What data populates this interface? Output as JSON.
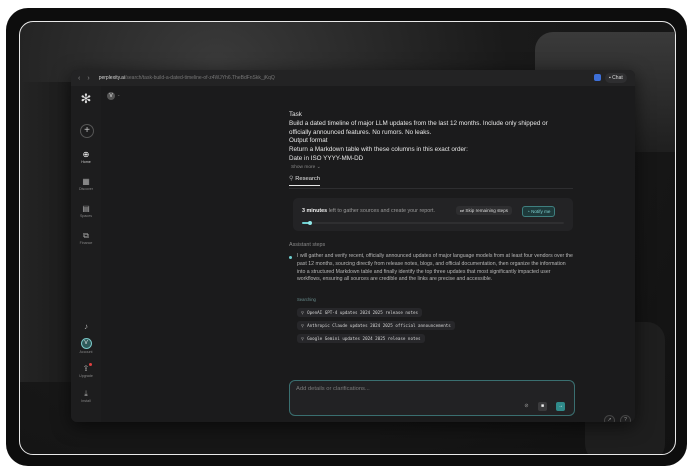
{
  "browser": {
    "url_domain": "perplexity.ai",
    "url_path": "/search/task-build-a-dated-timeline-of-z4WJYh6.TheBdFnSkk_jKqQ",
    "chat_label": "Chat"
  },
  "sidebar": {
    "items": [
      {
        "label": "Home",
        "icon": "magnifier-icon"
      },
      {
        "label": "Discover",
        "icon": "compass-icon"
      },
      {
        "label": "Spaces",
        "icon": "stack-icon"
      },
      {
        "label": "Finance",
        "icon": "chart-icon"
      }
    ],
    "account_label": "Account",
    "account_initial": "V",
    "upgrade_label": "Upgrade",
    "install_label": "Install"
  },
  "user": {
    "initial": "V"
  },
  "task": {
    "heading": "Task",
    "line1": "Build a dated timeline of major LLM updates from the last 12 months. Include only shipped or officially announced features. No rumors. No leaks.",
    "output_heading": "Output format",
    "line2": "Return a Markdown table with these columns in this exact order:",
    "line3": "Date in ISO YYYY-MM-DD",
    "show_more": "Show more"
  },
  "tab": {
    "label": "Research"
  },
  "progress": {
    "time": "3 minutes",
    "text": " left to gather sources and create your report.",
    "skip_label": "Skip remaining steps",
    "notify_label": "Notify me",
    "fraction": 0.03
  },
  "assistant": {
    "heading": "Assistant steps",
    "text": "I will gather and verify recent, officially announced updates of major language models from at least four vendors over the past 12 months, sourcing directly from release notes, blogs, and official documentation, then organize the information into a structured Markdown table and finally identify the top three updates that most significantly impacted user workflows, ensuring all sources are credible and the links are precise and accessible.",
    "searching_label": "Searching",
    "queries": [
      "OpenAI GPT-4 updates 2024 2025 release notes",
      "Anthropic Claude updates 2024 2025 official announcements",
      "Google Gemini updates 2024 2025 release notes"
    ]
  },
  "composer": {
    "placeholder": "Add details or clarifications..."
  },
  "accent": "#6fd0d0"
}
